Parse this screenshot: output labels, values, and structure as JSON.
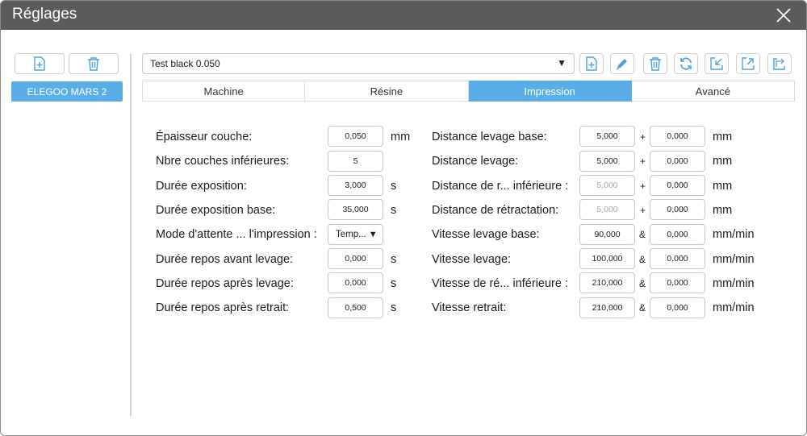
{
  "window": {
    "title": "Réglages",
    "close_icon": "close-icon"
  },
  "sidebar": {
    "add_icon": "add-file-icon",
    "delete_icon": "trash-icon",
    "printers": [
      "ELEGOO MARS 2"
    ]
  },
  "profile": {
    "selected": "Test black 0.050",
    "toolbar_icons": [
      "add-file-icon",
      "edit-pencil-icon",
      "trash-icon",
      "refresh-icon",
      "import-icon",
      "export-icon",
      "export-all-icon"
    ]
  },
  "tabs": [
    {
      "label": "Machine",
      "active": false
    },
    {
      "label": "Résine",
      "active": false
    },
    {
      "label": "Impression",
      "active": true
    },
    {
      "label": "Avancé",
      "active": false
    }
  ],
  "left_settings": [
    {
      "label": "Épaisseur couche:",
      "value": "0,050",
      "unit": "mm"
    },
    {
      "label": "Nbre couches inférieures:",
      "value": "5",
      "unit": ""
    },
    {
      "label": "Durée exposition:",
      "value": "3,000",
      "unit": "s"
    },
    {
      "label": "Durée exposition base:",
      "value": "35,000",
      "unit": "s"
    },
    {
      "label": "Mode d'attente ... l'impression :",
      "value": "Temp...",
      "unit": "",
      "type": "dropdown"
    },
    {
      "label": "Durée repos avant levage:",
      "value": "0,000",
      "unit": "s"
    },
    {
      "label": "Durée repos après levage:",
      "value": "0,000",
      "unit": "s"
    },
    {
      "label": "Durée repos après retrait:",
      "value": "0,500",
      "unit": "s"
    }
  ],
  "right_settings": [
    {
      "label": "Distance levage base:",
      "value1": "5,000",
      "sep": "+",
      "value2": "0,000",
      "unit": "mm",
      "disabled": false
    },
    {
      "label": "Distance levage:",
      "value1": "5,000",
      "sep": "+",
      "value2": "0,000",
      "unit": "mm",
      "disabled": false
    },
    {
      "label": "Distance de r... inférieure :",
      "value1": "5,000",
      "sep": "+",
      "value2": "0,000",
      "unit": "mm",
      "disabled": true
    },
    {
      "label": "Distance de rétractation:",
      "value1": "5,000",
      "sep": "+",
      "value2": "0,000",
      "unit": "mm",
      "disabled": true
    },
    {
      "label": "Vitesse levage base:",
      "value1": "90,000",
      "sep": "&",
      "value2": "0,000",
      "unit": "mm/min",
      "disabled": false
    },
    {
      "label": "Vitesse levage:",
      "value1": "100,000",
      "sep": "&",
      "value2": "0,000",
      "unit": "mm/min",
      "disabled": false
    },
    {
      "label": "Vitesse de ré... inférieure :",
      "value1": "210,000",
      "sep": "&",
      "value2": "0,000",
      "unit": "mm/min",
      "disabled": false
    },
    {
      "label": "Vitesse retrait:",
      "value1": "210,000",
      "sep": "&",
      "value2": "0,000",
      "unit": "mm/min",
      "disabled": false
    }
  ],
  "colors": {
    "titlebar": "#5b5b5b",
    "accent": "#5aaee8",
    "icon": "#4aa3e0"
  }
}
